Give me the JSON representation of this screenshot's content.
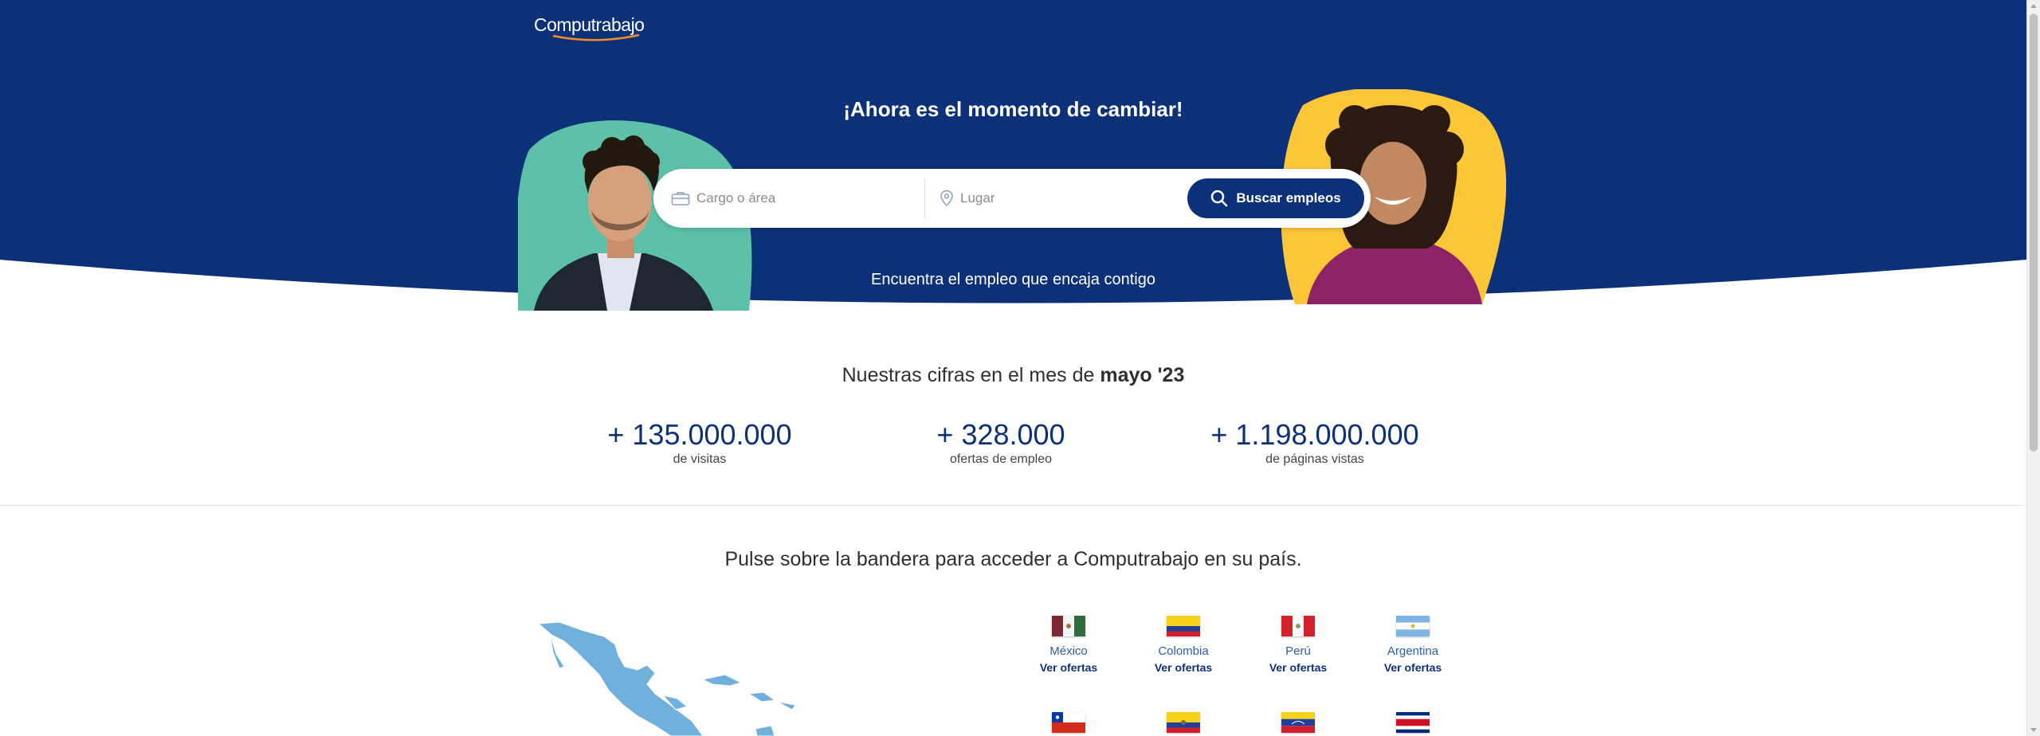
{
  "header": {
    "logo_text": "Computrabajo"
  },
  "hero": {
    "title": "¡Ahora es el momento de cambiar!",
    "subtitle": "Encuentra el empleo que encaja contigo",
    "search": {
      "cargo_placeholder": "Cargo o área",
      "lugar_placeholder": "Lugar",
      "button_label": "Buscar empleos"
    }
  },
  "stats": {
    "title_prefix": "Nuestras cifras en el mes de",
    "title_month": "mayo '23",
    "items": [
      {
        "number": "+ 135.000.000",
        "label": "de visitas"
      },
      {
        "number": "+ 328.000",
        "label": "ofertas de empleo"
      },
      {
        "number": "+ 1.198.000.000",
        "label": "de páginas vistas"
      }
    ]
  },
  "countries": {
    "title": "Pulse sobre la bandera para acceder a Computrabajo en su país.",
    "cta": "Ver ofertas",
    "items": [
      {
        "name": "México"
      },
      {
        "name": "Colombia"
      },
      {
        "name": "Perú"
      },
      {
        "name": "Argentina"
      }
    ],
    "second_row_flags": [
      "chile-flag",
      "ecuador-flag",
      "venezuela-flag",
      "costa-rica-flag"
    ]
  },
  "colors": {
    "brand_navy": "#0d3178",
    "accent_orange": "#f28c28",
    "blob_teal": "#5cc1a8",
    "blob_yellow": "#fcc638",
    "link_blue": "#2f5e9e"
  },
  "icons": {
    "briefcase": "briefcase-icon",
    "location": "location-pin-icon",
    "search": "search-icon"
  }
}
